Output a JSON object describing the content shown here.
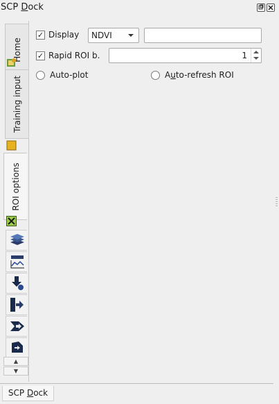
{
  "window": {
    "title": "SCP Dock",
    "title_mnemonic": "D"
  },
  "tabs": [
    {
      "label": "Home"
    },
    {
      "label": "Training input"
    },
    {
      "label": "ROI options"
    }
  ],
  "roi_options": {
    "display_label": "Display",
    "display_checked": true,
    "display_index": "NDVI",
    "expression_value": "",
    "rapid_roi_label": "Rapid ROI b.",
    "rapid_roi_checked": true,
    "rapid_roi_band": "1",
    "auto_plot_label": "Auto-plot",
    "auto_refresh_label": "Auto-refresh ROI",
    "auto_refresh_mnemonic": "u"
  },
  "bottom_tab": {
    "label": "SCP Dock"
  },
  "icons": [
    "float-icon",
    "close-icon",
    "home-tab-icon",
    "training-tab-icon",
    "roi-tab-icon",
    "layers-icon",
    "spectral-plot-icon",
    "download-icon",
    "import-icon",
    "export-icon",
    "preprocessing-icon",
    "scroll-up-icon",
    "scroll-down-icon"
  ]
}
